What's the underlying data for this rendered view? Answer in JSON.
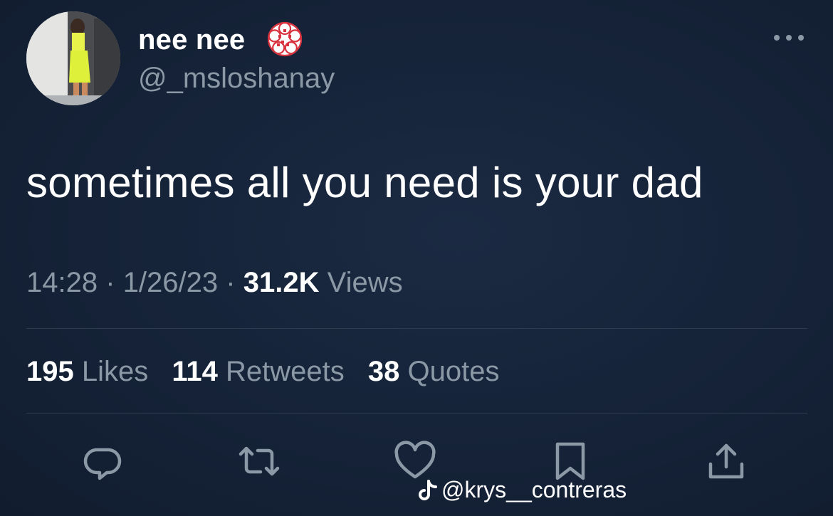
{
  "tweet": {
    "author": {
      "display_name": "nee nee",
      "handle": "@_msloshanay"
    },
    "text": "sometimes all you need is your dad",
    "time": "14:28",
    "date": "1/26/23",
    "separator": "·",
    "views_count": "31.2K",
    "views_label": "Views",
    "stats": {
      "likes_count": "195",
      "likes_label": "Likes",
      "retweets_count": "114",
      "retweets_label": "Retweets",
      "quotes_count": "38",
      "quotes_label": "Quotes"
    }
  },
  "actions": [
    "reply-icon",
    "retweet-icon",
    "like-icon",
    "bookmark-icon",
    "share-icon"
  ],
  "watermark": {
    "icon": "tiktok-icon",
    "text": "@krys__contreras"
  },
  "colors": {
    "background": "#152238",
    "secondary_text": "#8b98a5",
    "primary_text": "#ffffff",
    "divider": "#2f3b4d",
    "badge_red": "#d8323f"
  }
}
